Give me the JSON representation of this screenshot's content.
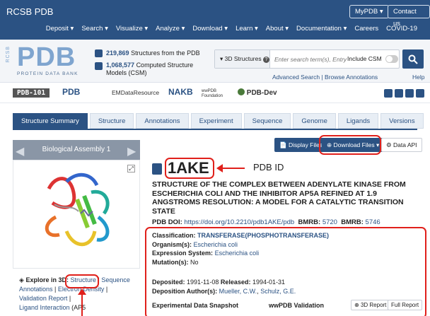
{
  "header": {
    "brand": "RCSB PDB",
    "mypdb_label": "MyPDB",
    "contact_label": "Contact us",
    "nav": [
      "Deposit",
      "Search",
      "Visualize",
      "Analyze",
      "Download",
      "Learn",
      "About",
      "Documentation",
      "Careers",
      "COVID-19"
    ]
  },
  "logo": {
    "rcsb": "RCSB",
    "pdb": "PDB",
    "subtitle": "PROTEIN DATA BANK"
  },
  "stats": {
    "structures_count": "219,869",
    "structures_text": "Structures from the PDB",
    "csm_count": "1,068,577",
    "csm_text_1": "Computed Structure",
    "csm_text_2": "Models (CSM)"
  },
  "search": {
    "category": "3D Structures",
    "placeholder": "Enter search term(s), Entry ID(s), or sequence",
    "include_csm": "Include CSM",
    "advanced": "Advanced Search",
    "annotations": "Browse Annotations",
    "help": "Help"
  },
  "partners": [
    "PDB-101",
    "PDB",
    "EMDataResource",
    "NAKB",
    "wwPDB Foundation",
    "PDB-Dev"
  ],
  "tabs": [
    "Structure Summary",
    "Structure",
    "Annotations",
    "Experiment",
    "Sequence",
    "Genome",
    "Ligands",
    "Versions"
  ],
  "assembly": {
    "title": "Biological Assembly 1"
  },
  "explore": {
    "prefix": "Explore in 3D:",
    "structure": "Structure",
    "sequence": "Sequence",
    "annotations": "Annotations",
    "electron": "Electron Density",
    "validation": "Validation Report",
    "ligand": "Ligand Interaction",
    "ligand_suffix": "(AP5"
  },
  "actions": {
    "display_files": "Display Files",
    "download_files": "Download Files",
    "data_api": "Data API"
  },
  "entry": {
    "id": "1AKE",
    "annotation": "PDB ID",
    "title": "STRUCTURE OF THE COMPLEX BETWEEN ADENYLATE KINASE FROM ESCHERICHIA COLI AND THE INHIBITOR AP5A REFINED AT 1.9 ANGSTROMS RESOLUTION: A MODEL FOR A CATALYTIC TRANSITION STATE",
    "doi_label": "PDB DOI:",
    "doi": "https://doi.org/10.2210/pdb1AKE/pdb",
    "bmrb_label": "BMRB:",
    "bmrb_1": "5720",
    "bmrb_2": "5746",
    "classification_label": "Classification:",
    "classification": "TRANSFERASE(PHOSPHOTRANSFERASE)",
    "organism_label": "Organism(s):",
    "organism": "Escherichia coli",
    "expression_label": "Expression System:",
    "expression": "Escherichia coli",
    "mutation_label": "Mutation(s):",
    "mutation": "No",
    "deposited_label": "Deposited:",
    "deposited": "1991-11-08",
    "released_label": "Released:",
    "released": "1994-01-31",
    "authors_label": "Deposition Author(s):",
    "author_1": "Mueller, C.W.",
    "author_2": "Schulz, G.E.",
    "snapshot": "Experimental Data Snapshot",
    "wwpdb": "wwPDB Validation",
    "report_3d": "3D Report",
    "full_report": "Full Report"
  },
  "colors": {
    "brand": "#2b5283",
    "annotation_red": "#e0201b"
  }
}
